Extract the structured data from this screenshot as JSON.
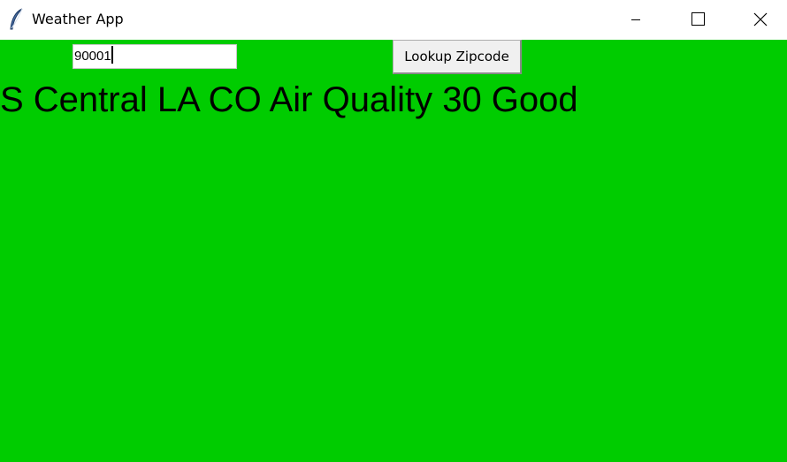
{
  "window": {
    "title": "Weather App",
    "icon": "feather-icon",
    "controls": {
      "minimize_icon": "minimize-icon",
      "maximize_icon": "maximize-icon",
      "close_icon": "close-icon"
    }
  },
  "form": {
    "zip_value": "90001",
    "lookup_button_label": "Lookup Zipcode"
  },
  "result": {
    "text": "S Central LA CO Air Quality 30 Good"
  },
  "colors": {
    "background": "#00cc00",
    "titlebar": "#ffffff",
    "text": "#000000"
  }
}
